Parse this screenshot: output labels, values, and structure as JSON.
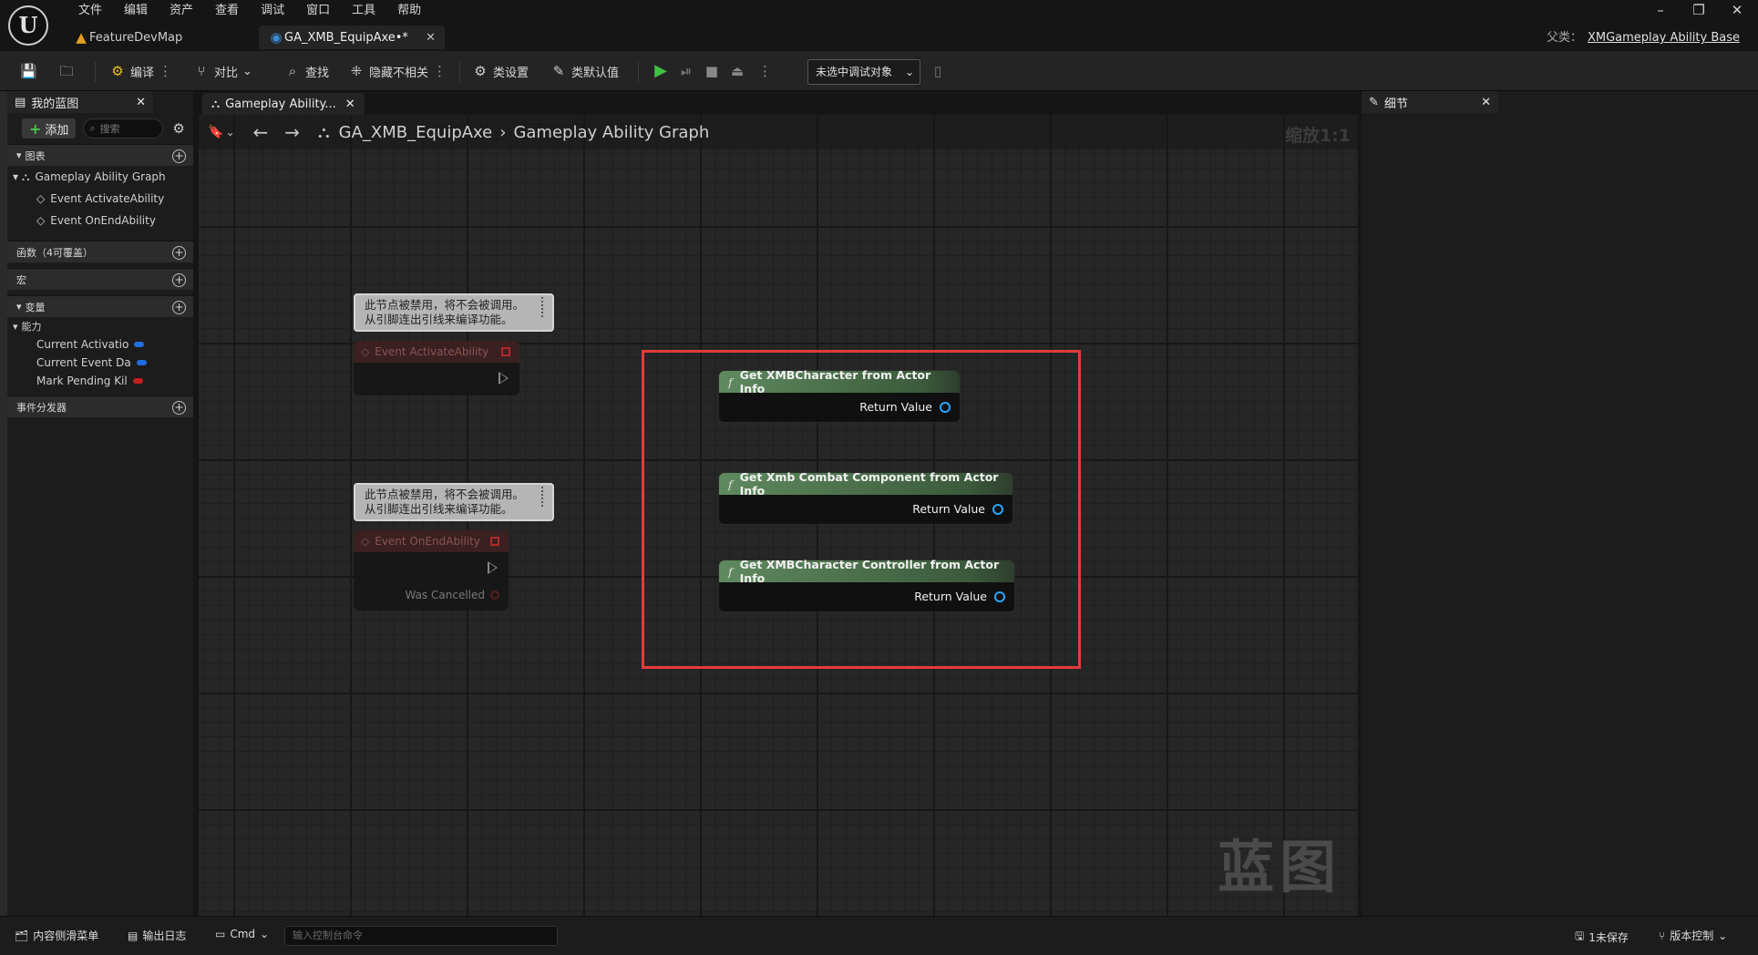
{
  "menu": [
    "文件",
    "编辑",
    "资产",
    "查看",
    "调试",
    "窗口",
    "工具",
    "帮助"
  ],
  "tabs": [
    {
      "label": "FeatureDevMap"
    },
    {
      "label": "GA_XMB_EquipAxe•*"
    }
  ],
  "parent_class": {
    "label": "父类：",
    "value": "XMGameplay Ability Base"
  },
  "toolbar": {
    "compile": "编译",
    "diff": "对比",
    "find": "查找",
    "hide_unrelated": "隐藏不相关",
    "class_settings": "类设置",
    "class_defaults": "类默认值",
    "debug_target": "未选中调试对象"
  },
  "my_blueprint": {
    "title": "我的蓝图",
    "add": "添加",
    "search_placeholder": "搜索",
    "graphs_section": "图表",
    "graph_name": "Gameplay Ability Graph",
    "events": [
      "Event ActivateAbility",
      "Event OnEndAbility"
    ],
    "functions_section": "函数（4可覆盖）",
    "macros_section": "宏",
    "variables_section": "变量",
    "category": "能力",
    "variables": [
      {
        "name": "Current Activatio",
        "color": "#1f6fe0"
      },
      {
        "name": "Current Event Da",
        "color": "#1f6fe0"
      },
      {
        "name": "Mark Pending Kil",
        "color": "#c42020"
      }
    ],
    "dispatchers_section": "事件分发器"
  },
  "graph_tab": {
    "label": "Gameplay Ability..."
  },
  "graph": {
    "breadcrumb_asset": "GA_XMB_EquipAxe",
    "breadcrumb_graph": "Gameplay Ability Graph",
    "zoom": "缩放1:1",
    "watermark": "蓝图",
    "comment_line1": "此节点被禁用，将不会被调用。",
    "comment_line2": "从引脚连出引线来编译功能。",
    "event_activate": "Event ActivateAbility",
    "event_end": "Event OnEndAbility",
    "was_cancelled": "Was Cancelled",
    "nodes": [
      {
        "title": "Get XMBCharacter from Actor Info",
        "pin": "Return Value"
      },
      {
        "title": "Get Xmb Combat Component from Actor Info",
        "pin": "Return Value"
      },
      {
        "title": "Get XMBCharacter Controller from Actor Info",
        "pin": "Return Value"
      }
    ]
  },
  "details": {
    "title": "细节"
  },
  "status": {
    "content_drawer": "内容侧滑菜单",
    "output_log": "输出日志",
    "cmd": "Cmd",
    "cmd_placeholder": "输入控制台命令",
    "unsaved": "1未保存",
    "source_control": "版本控制"
  },
  "colors": {
    "selection_box": "#e53a3a",
    "func_header": "#5f8a5f",
    "pin": "#2aa6ff",
    "play": "#3fc042"
  }
}
